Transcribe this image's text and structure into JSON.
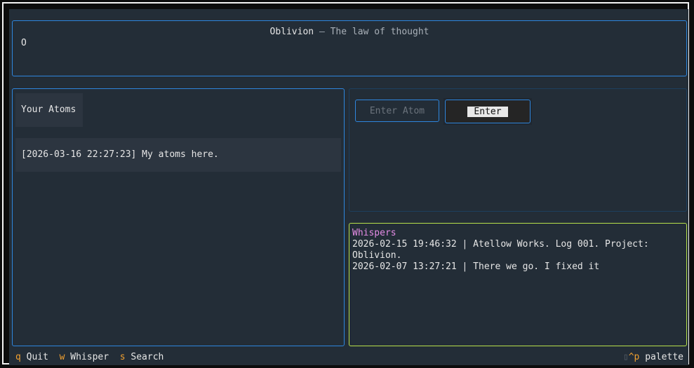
{
  "header": {
    "app_name": "Oblivion",
    "separator": " — ",
    "subtitle": "The law of thought",
    "body_text": "O"
  },
  "atoms": {
    "label": "Your Atoms",
    "items": [
      "[2026-03-16 22:27:23] My atoms here."
    ]
  },
  "input": {
    "placeholder": "Enter Atom",
    "button_label": "Enter"
  },
  "whispers": {
    "title": "Whispers",
    "lines": [
      "2026-02-15 19:46:32 | Atellow Works. Log 001. Project: Oblivion.",
      "2026-02-07 13:27:21 | There we go. I fixed it"
    ]
  },
  "footer": {
    "bindings": [
      {
        "key": "q",
        "label": "Quit"
      },
      {
        "key": "w",
        "label": "Whisper"
      },
      {
        "key": "s",
        "label": "Search"
      }
    ],
    "palette_icon": "▯",
    "palette_key": "^p",
    "palette_label": "palette"
  },
  "colors": {
    "accent_blue": "#2e86de",
    "whispers_border": "#b8e04a",
    "whispers_title": "#e58ce6",
    "key_orange": "#f0a030",
    "background": "#232d37"
  }
}
